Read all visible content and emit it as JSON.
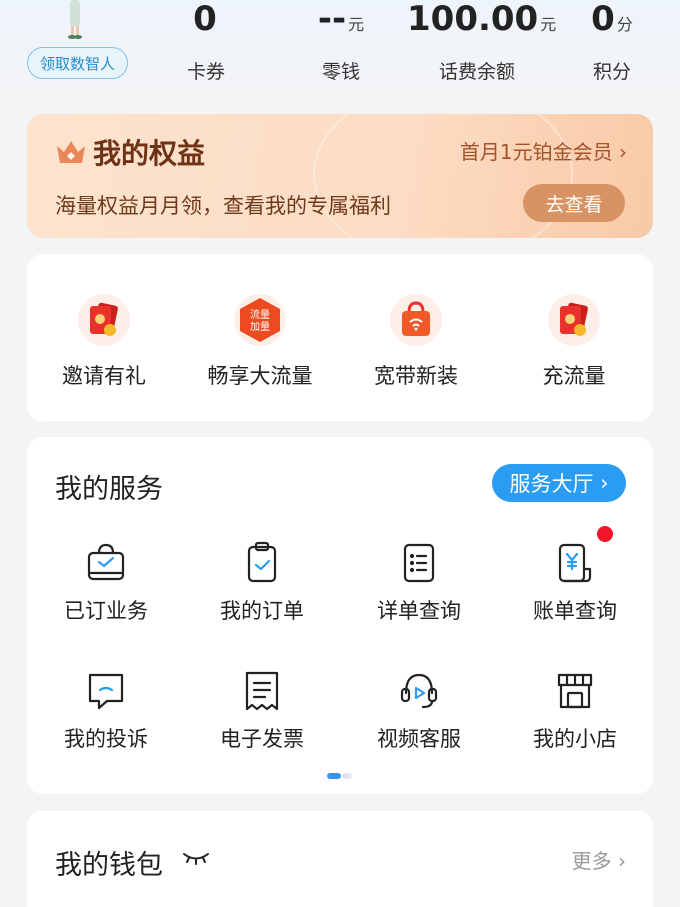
{
  "header": {
    "avatar_button": "领取数智人",
    "stats": [
      {
        "value": "0",
        "unit": "",
        "label": "卡券"
      },
      {
        "value": "--",
        "unit": "元",
        "label": "零钱"
      },
      {
        "value": "100.00",
        "unit": "元",
        "label": "话费余额"
      },
      {
        "value": "0",
        "unit": "分",
        "label": "积分"
      }
    ]
  },
  "rights": {
    "title": "我的权益",
    "vip_link": "首月1元铂金会员",
    "description": "海量权益月月领，查看我的专属福利",
    "button": "去查看"
  },
  "promo": {
    "items": [
      {
        "label": "邀请有礼",
        "icon": "red-envelope-icon"
      },
      {
        "label": "畅享大流量",
        "icon": "data-boost-icon",
        "badge_lines": [
          "流量",
          "加量"
        ]
      },
      {
        "label": "宽带新装",
        "icon": "broadband-bag-icon"
      },
      {
        "label": "充流量",
        "icon": "red-envelope-icon"
      }
    ]
  },
  "services": {
    "title": "我的服务",
    "hall_button": "服务大厅",
    "items": [
      {
        "label": "已订业务",
        "icon": "subscribed-icon"
      },
      {
        "label": "我的订单",
        "icon": "order-clipboard-icon"
      },
      {
        "label": "详单查询",
        "icon": "detail-list-icon"
      },
      {
        "label": "账单查询",
        "icon": "bill-icon",
        "has_notification": true
      },
      {
        "label": "我的投诉",
        "icon": "complaint-icon"
      },
      {
        "label": "电子发票",
        "icon": "invoice-icon"
      },
      {
        "label": "视频客服",
        "icon": "video-service-icon"
      },
      {
        "label": "我的小店",
        "icon": "shop-icon"
      }
    ]
  },
  "wallet": {
    "title": "我的钱包",
    "more": "更多"
  },
  "colors": {
    "accent": "#2a9cf2",
    "rights_text": "#6e3216",
    "promo_red": "#e8322b",
    "notification": "#f2152a"
  }
}
